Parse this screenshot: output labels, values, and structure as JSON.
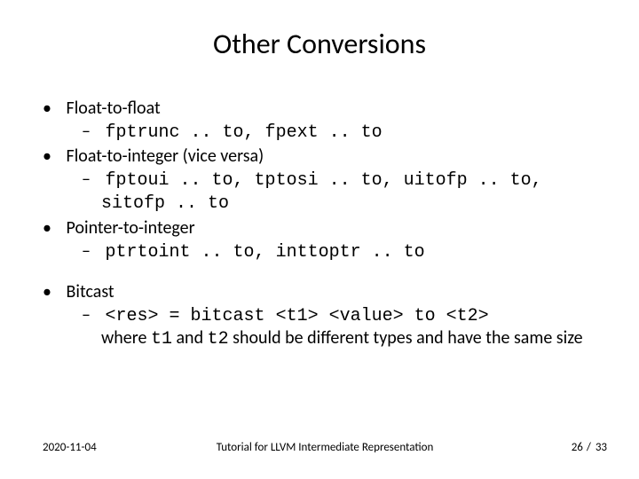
{
  "title": "Other Conversions",
  "bullets": {
    "b1": "Float-to-float",
    "b1s1": "fptrunc .. to, fpext .. to",
    "b2": "Float-to-integer (vice versa)",
    "b2s1": "fptoui .. to, tptosi .. to, uitofp .. to, sitofp .. to",
    "b3": "Pointer-to-integer",
    "b3s1": "ptrtoint .. to, inttoptr .. to",
    "b4": "Bitcast",
    "b4s1_code": "<res> = bitcast <t1> <value> to <t2>",
    "b4s1_tail_a": "where ",
    "b4s1_t1": "t1",
    "b4s1_mid": " and ",
    "b4s1_t2": "t2",
    "b4s1_tail_b": " should be different types and have the same size"
  },
  "footer": {
    "date": "2020-11-04",
    "title": "Tutorial for LLVM Intermediate Representation",
    "page_current": "26",
    "page_sep": " / ",
    "page_total": "33"
  }
}
